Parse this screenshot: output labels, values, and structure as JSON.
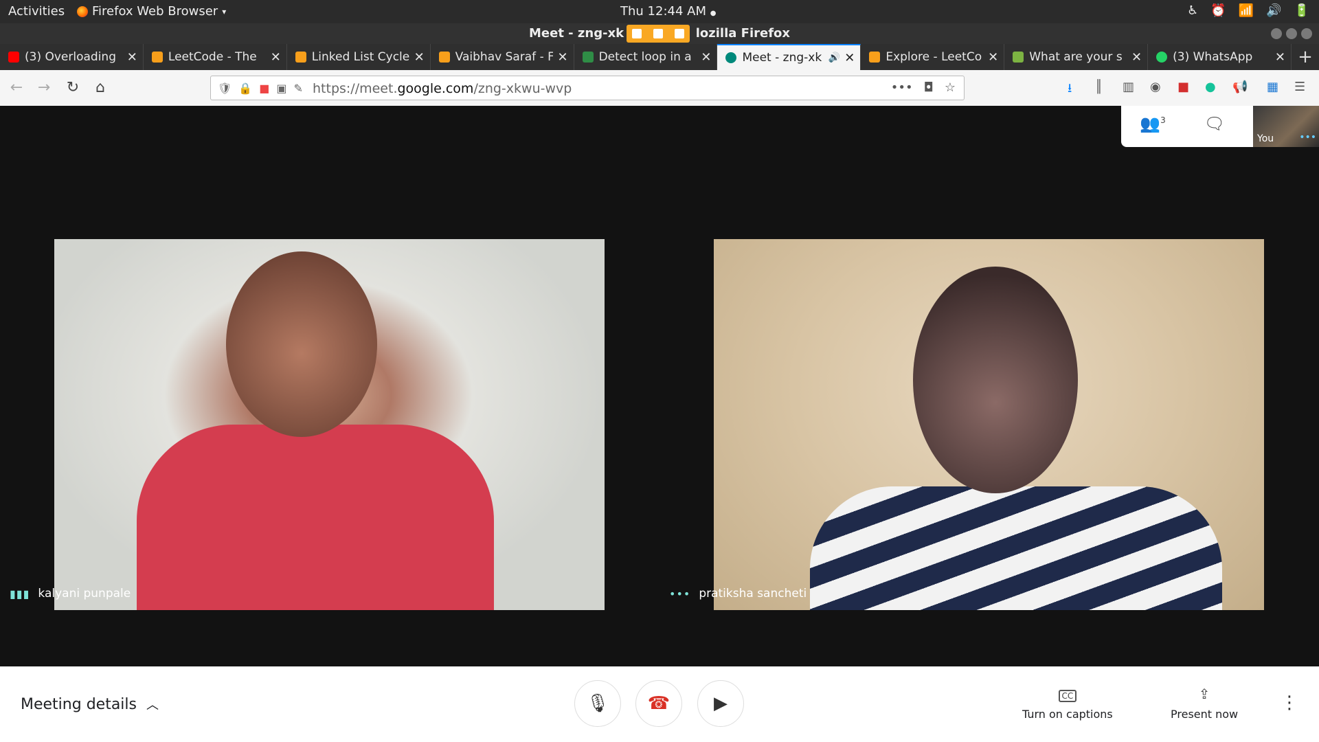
{
  "topbar": {
    "activities": "Activities",
    "app_name": "Firefox Web Browser",
    "app_caret": "▾",
    "clock": "Thu 12:44 AM",
    "clock_dot": "●",
    "icons": [
      "accessibility-icon",
      "alarm-icon",
      "wifi-icon",
      "volume-icon",
      "battery-icon"
    ]
  },
  "window": {
    "title_left": "Meet - zng-xk",
    "title_right": "lozilla Firefox"
  },
  "tabs": [
    {
      "label": "(3) Overloading",
      "favicon_color": "#ff0000",
      "active": false
    },
    {
      "label": "LeetCode - The",
      "favicon_color": "#f89f1b",
      "active": false
    },
    {
      "label": "Linked List Cycle",
      "favicon_color": "#f89f1b",
      "active": false
    },
    {
      "label": "Vaibhav Saraf - F",
      "favicon_color": "#f89f1b",
      "active": false
    },
    {
      "label": "Detect loop in a",
      "favicon_color": "#2f8d46",
      "active": false
    },
    {
      "label": "Meet - zng-xk",
      "favicon_color": "#00897b",
      "active": true
    },
    {
      "label": "Explore - LeetCo",
      "favicon_color": "#f89f1b",
      "active": false
    },
    {
      "label": "What are your s",
      "favicon_color": "#7cb342",
      "active": false
    },
    {
      "label": "(3) WhatsApp",
      "favicon_color": "#25d366",
      "active": false
    }
  ],
  "tab_close": "✕",
  "tab_audio": "🔊",
  "new_tab": "+",
  "nav": {
    "back": "←",
    "forward": "→",
    "reload": "↻",
    "home": "⌂",
    "url_prefix": "https://meet.",
    "url_domain": "google.com",
    "url_path": "/zng-xkwu-wvp",
    "page_actions": "•••"
  },
  "meet": {
    "participants_count": "3",
    "self_label": "You",
    "tiles": [
      {
        "name": "kalyani punpale",
        "indicator": "▮▮▮"
      },
      {
        "name": "pratiksha sancheti",
        "indicator": "•••"
      }
    ]
  },
  "controls": {
    "meeting_details": "Meeting details",
    "captions": "Turn on captions",
    "present": "Present now",
    "captions_icon": "CC"
  }
}
